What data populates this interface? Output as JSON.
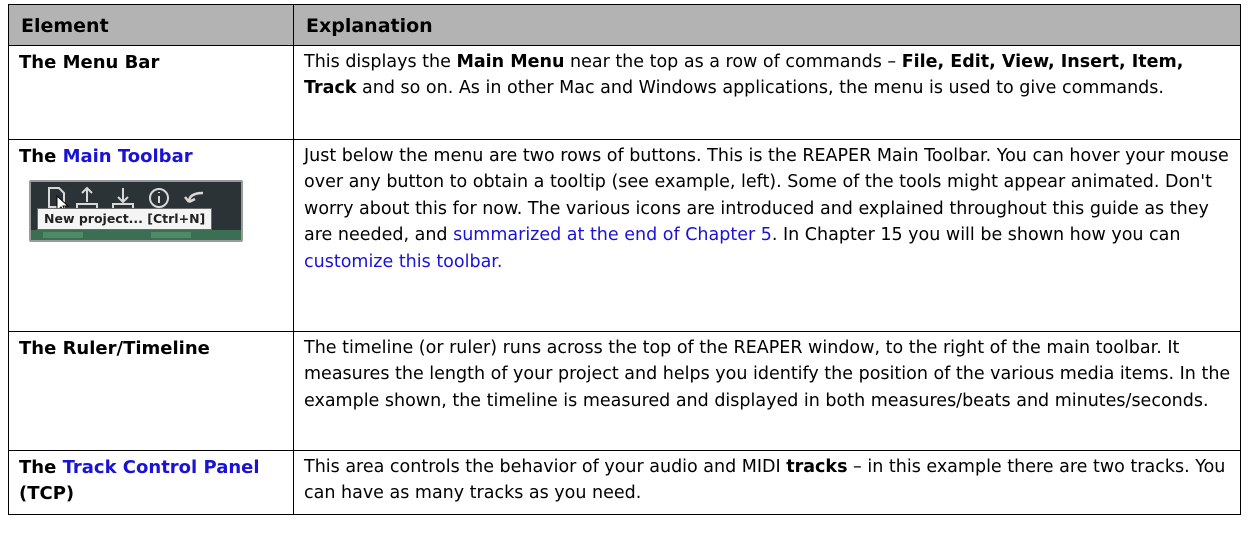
{
  "header": {
    "element": "Element",
    "explanation": "Explanation"
  },
  "rows": [
    {
      "element": "The Menu Bar",
      "text": [
        "This displays the ",
        "Main Menu",
        " near the top as a row of commands – ",
        "File, Edit, View, Insert, Item, Track",
        " and so on. As in other Mac and Windows applications, the menu is used to give commands."
      ]
    },
    {
      "element_prefix": "The ",
      "element_link": "Main Toolbar",
      "thumbnail": {
        "tooltip": "New project... [Ctrl+N]"
      },
      "text": [
        "Just below the menu are two rows of buttons. This is the REAPER Main Toolbar. You can hover your mouse over any button to obtain a tooltip (see example, left). Some of the tools might appear animated. Don't worry about this for now. The various icons are introduced and explained throughout this guide as they are needed, and ",
        "summarized at the end of Chapter 5",
        ". In Chapter 15 you will be shown how you can ",
        "customize this toolbar."
      ]
    },
    {
      "element": "The Ruler/Timeline",
      "text": [
        "The timeline (or ruler) runs across the top of the REAPER window, to the right of the main toolbar. It measures the length of your project and helps you identify the position of the various media items. In the example shown, the timeline is measured and displayed in both measures/beats and minutes/seconds."
      ]
    },
    {
      "element_prefix": "The ",
      "element_link": "Track Control Panel",
      "element_suffix": " (TCP)",
      "text": [
        "This area controls the behavior of your audio and MIDI ",
        "tracks",
        " – in this example there are two tracks. You can have as many tracks as you need."
      ]
    }
  ],
  "colors": {
    "header_bg": "#b3b3b3",
    "link": "#1a12d6",
    "border": "#000000"
  }
}
